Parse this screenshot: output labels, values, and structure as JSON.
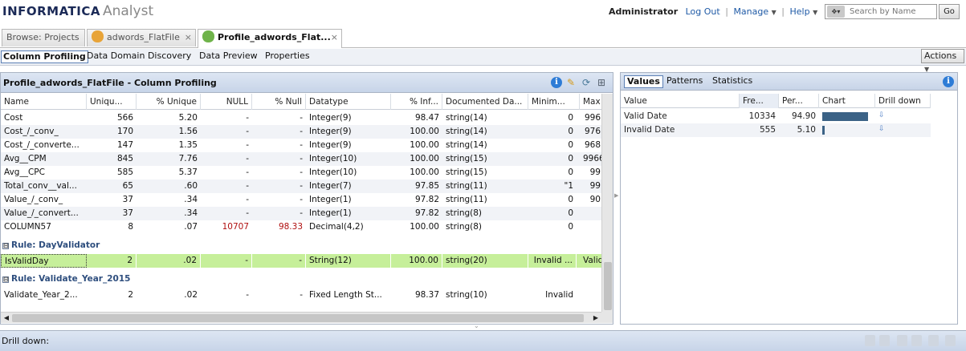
{
  "app": {
    "brand": "INFORMATICA",
    "product": "Analyst"
  },
  "topnav": {
    "user": "Administrator",
    "logout": "Log Out",
    "manage": "Manage",
    "help": "Help",
    "search_placeholder": "Search by Name",
    "go": "Go"
  },
  "tabs": [
    {
      "label": "Browse: Projects"
    },
    {
      "label": "adwords_FlatFile",
      "close": "×"
    },
    {
      "label": "Profile_adwords_Flat...",
      "close": "×"
    }
  ],
  "submenu": {
    "items": [
      "Column Profiling",
      "Data Domain Discovery",
      "Data Preview",
      "Properties"
    ],
    "actions": "Actions"
  },
  "left": {
    "title": "Profile_adwords_FlatFile - Column Profiling",
    "columns": [
      "Name",
      "Uniqu...",
      "% Unique",
      "NULL",
      "% Null",
      "Datatype",
      "% Inf...",
      "Documented Da...",
      "Minim...",
      "Max"
    ],
    "rows": [
      [
        "Cost",
        "566",
        "5.20",
        "-",
        "-",
        "Integer(9)",
        "98.47",
        "string(14)",
        "0",
        "996"
      ],
      [
        "Cost_/_conv_",
        "170",
        "1.56",
        "-",
        "-",
        "Integer(9)",
        "100.00",
        "string(14)",
        "0",
        "976"
      ],
      [
        "Cost_/_converte...",
        "147",
        "1.35",
        "-",
        "-",
        "Integer(9)",
        "100.00",
        "string(14)",
        "0",
        "968"
      ],
      [
        "Avg__CPM",
        "845",
        "7.76",
        "-",
        "-",
        "Integer(10)",
        "100.00",
        "string(15)",
        "0",
        "9966"
      ],
      [
        "Avg__CPC",
        "585",
        "5.37",
        "-",
        "-",
        "Integer(10)",
        "100.00",
        "string(15)",
        "0",
        "99"
      ],
      [
        "Total_conv__val...",
        "65",
        ".60",
        "-",
        "-",
        "Integer(7)",
        "97.85",
        "string(11)",
        "\"1",
        "99"
      ],
      [
        "Value_/_conv_",
        "37",
        ".34",
        "-",
        "-",
        "Integer(1)",
        "97.82",
        "string(11)",
        "0",
        "90"
      ],
      [
        "Value_/_convert...",
        "37",
        ".34",
        "-",
        "-",
        "Integer(1)",
        "97.82",
        "string(8)",
        "0",
        ""
      ],
      [
        "COLUMN57",
        "8",
        ".07",
        "10707",
        "98.33",
        "Decimal(4,2)",
        "100.00",
        "string(8)",
        "0",
        ""
      ]
    ],
    "rule1": {
      "toggle": "⊟",
      "label": "Rule: DayValidator"
    },
    "rule1_row": [
      "IsValidDay",
      "2",
      ".02",
      "-",
      "-",
      "String(12)",
      "100.00",
      "string(20)",
      "Invalid ...",
      "Valid"
    ],
    "rule2": {
      "toggle": "⊟",
      "label": "Rule: Validate_Year_2015"
    },
    "rule2_row": [
      "Validate_Year_2...",
      "2",
      ".02",
      "-",
      "-",
      "Fixed Length St...",
      "98.37",
      "string(10)",
      "Invalid",
      ""
    ]
  },
  "right": {
    "tabs": [
      "Values",
      "Patterns",
      "Statistics"
    ],
    "columns": [
      "Value",
      "Fre...",
      "Per...",
      "Chart",
      "Drill down"
    ],
    "rows": [
      {
        "value": "Valid Date",
        "freq": "10334",
        "pct": "94.90",
        "bar_pct": 94.9
      },
      {
        "value": "Invalid Date",
        "freq": "555",
        "pct": "5.10",
        "bar_pct": 5.1
      }
    ]
  },
  "bottom": {
    "label": "Drill down:"
  }
}
